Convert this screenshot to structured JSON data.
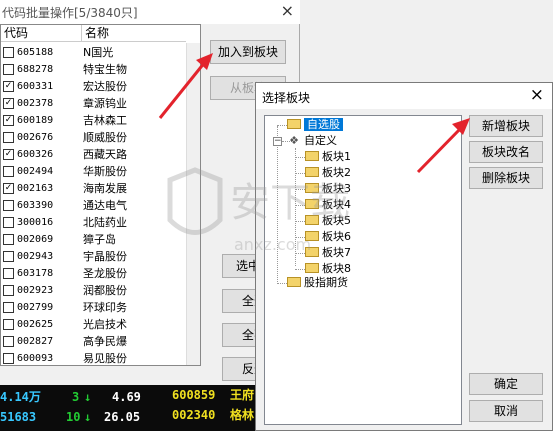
{
  "main_window": {
    "title": "代码批量操作[5/3840只]",
    "close": "×"
  },
  "list": {
    "col_code": "代码",
    "col_name": "名称",
    "rows": [
      {
        "code": "605188",
        "name": "N国光",
        "checked": false
      },
      {
        "code": "688278",
        "name": "特宝生物",
        "checked": false
      },
      {
        "code": "600331",
        "name": "宏达股份",
        "checked": true
      },
      {
        "code": "002378",
        "name": "章源钨业",
        "checked": true
      },
      {
        "code": "600189",
        "name": "吉林森工",
        "checked": true
      },
      {
        "code": "002676",
        "name": "顺威股份",
        "checked": false
      },
      {
        "code": "600326",
        "name": "西藏天路",
        "checked": true
      },
      {
        "code": "002494",
        "name": "华斯股份",
        "checked": false
      },
      {
        "code": "002163",
        "name": "海南发展",
        "checked": true
      },
      {
        "code": "603390",
        "name": "通达电气",
        "checked": false
      },
      {
        "code": "300016",
        "name": "北陆药业",
        "checked": false
      },
      {
        "code": "002069",
        "name": "獐子岛",
        "checked": false
      },
      {
        "code": "002943",
        "name": "宇晶股份",
        "checked": false
      },
      {
        "code": "603178",
        "name": "圣龙股份",
        "checked": false
      },
      {
        "code": "002923",
        "name": "润都股份",
        "checked": false
      },
      {
        "code": "002799",
        "name": "环球印务",
        "checked": false
      },
      {
        "code": "002625",
        "name": "光启技术",
        "checked": false
      },
      {
        "code": "002827",
        "name": "高争民爆",
        "checked": false
      },
      {
        "code": "600093",
        "name": "易见股份",
        "checked": false
      }
    ]
  },
  "side_buttons": {
    "add_to_block": "加入到板块",
    "remove_from_block": "从板块",
    "select_partial": "选中ス",
    "select_all": "全选",
    "select_none": "全不",
    "invert": "反选"
  },
  "ticker": {
    "rows": [
      {
        "val": "4.14万",
        "num": "3",
        "arrow": "↓",
        "price": "4.69",
        "code": "600859",
        "name": "王府"
      },
      {
        "val": "51683",
        "num": "10",
        "arrow": "↓",
        "price": "26.05",
        "code": "002340",
        "name": "格林"
      }
    ]
  },
  "dialog": {
    "title": "选择板块",
    "close": "×",
    "tree": {
      "favorites": "自选股",
      "custom": "自定义",
      "blocks": [
        "板块1",
        "板块2",
        "板块3",
        "板块4",
        "板块5",
        "板块6",
        "板块7",
        "板块8"
      ],
      "futures": "股指期货"
    },
    "buttons": {
      "new_block": "新增板块",
      "rename_block": "板块改名",
      "delete_block": "删除板块",
      "ok": "确定",
      "cancel": "取消"
    }
  },
  "watermark": {
    "text": "安下载",
    "sub": "anxz.com"
  },
  "colors": {
    "selection": "#0078d7",
    "arrow": "#e3232c",
    "ticker_yellow": "#f0e020",
    "ticker_green": "#22cc33",
    "ticker_cyan": "#38c8ff"
  }
}
